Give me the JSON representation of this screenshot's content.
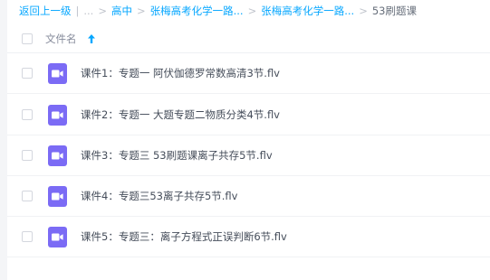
{
  "breadcrumb": {
    "back": "返回上一级",
    "sep_bar": "|",
    "ellipsis": "...",
    "crumb_1": "高中",
    "crumb_2": "张梅高考化学一路...",
    "crumb_3": "张梅高考化学一路...",
    "current": "53刷题课",
    "sep": ">"
  },
  "list_header": {
    "name_label": "文件名"
  },
  "files": [
    {
      "name": "课件1：专题一 阿伏伽德罗常数高清3节.flv",
      "icon": "video-icon"
    },
    {
      "name": "课件2：专题一 大题专题二物质分类4节.flv",
      "icon": "video-icon"
    },
    {
      "name": "课件3：专题三 53刷题课离子共存5节.flv",
      "icon": "video-icon"
    },
    {
      "name": "课件4：专题三53离子共存5节.flv",
      "icon": "video-icon"
    },
    {
      "name": "课件5：专题三：离子方程式正误判断6节.flv",
      "icon": "video-icon"
    }
  ],
  "colors": {
    "accent": "#06a7ff",
    "file_icon": "#7b6bf5"
  }
}
